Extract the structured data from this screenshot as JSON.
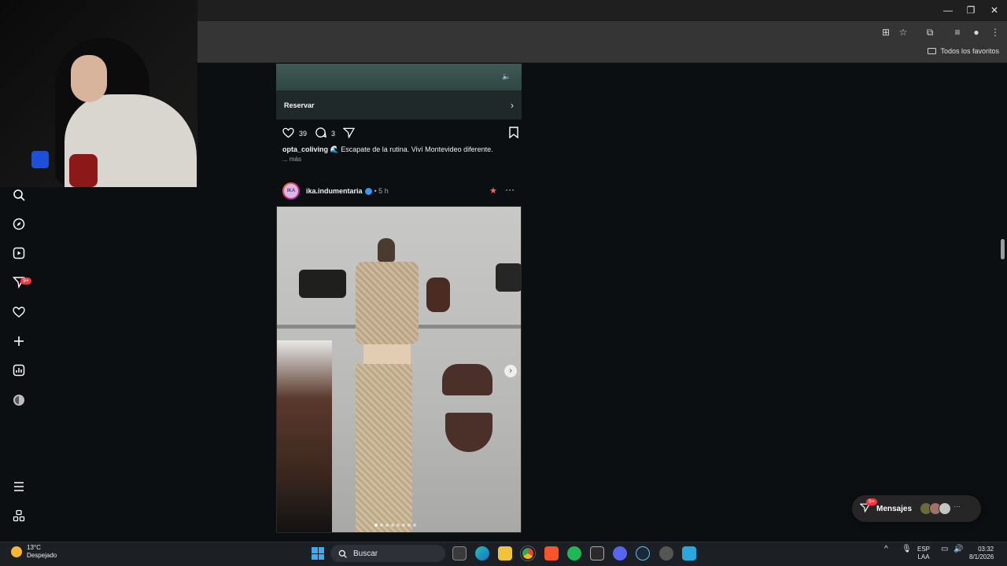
{
  "browser": {
    "bookmarks_all_label": "Todos los favoritos"
  },
  "sidebar": {
    "notifications_badge": "9+"
  },
  "feed": {
    "prev_post": {
      "cta_label": "Reservar",
      "likes": "39",
      "comments": "3",
      "caption_user": "opta_coliving",
      "caption_text": "🌊 Escapate de la rutina. Viví Montevideo diferente.",
      "more_label": "... más"
    },
    "post": {
      "avatar_text": "IKA",
      "username": "ika.indumentaria",
      "time": "• 5 h"
    }
  },
  "messages": {
    "label": "Mensajes",
    "badge": "9+"
  },
  "taskbar": {
    "temperature": "13°C",
    "weather": "Despejado",
    "search_placeholder": "Buscar",
    "lang_top": "ESP",
    "lang_bottom": "LAA",
    "time": "03:32",
    "date": "8/1/2026"
  }
}
